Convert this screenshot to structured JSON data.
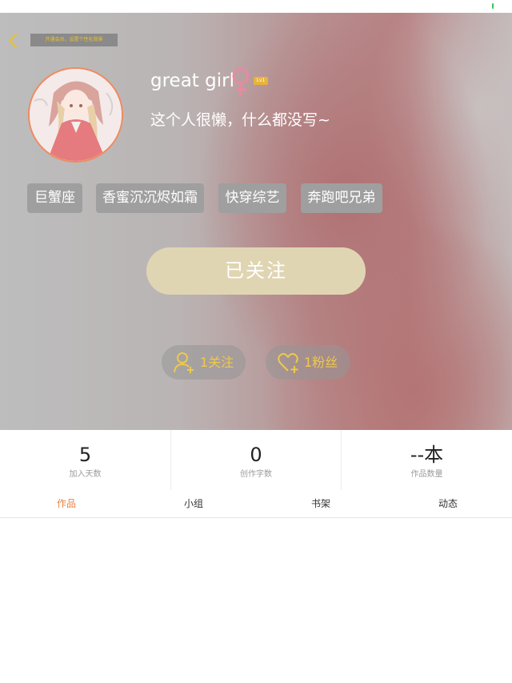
{
  "header": {
    "vip_banner": "开通会员，设置个性化背景"
  },
  "profile": {
    "username": "great girl",
    "gender": "female",
    "level": "Lv1",
    "signature": "这个人很懒，什么都没写~"
  },
  "tags": [
    "巨蟹座",
    "香蜜沉沉烬如霜",
    "快穿综艺",
    "奔跑吧兄弟"
  ],
  "follow_button": "已关注",
  "social": {
    "following": "1关注",
    "fans": "1粉丝"
  },
  "stats": [
    {
      "value": "5",
      "caption": "加入天数"
    },
    {
      "value": "0",
      "caption": "创作字数"
    },
    {
      "value": "--本",
      "caption": "作品数量"
    }
  ],
  "tabs": [
    "作品",
    "小组",
    "书架",
    "动态"
  ],
  "active_tab": "作品",
  "colors": {
    "accent": "#e8823e",
    "follow_button_bg": "#e0d5b3",
    "gold_text": "#eec94b",
    "gender_icon": "#e88aa0",
    "avatar_border": "#f08a5d"
  },
  "icons": {
    "back": "chevron-left-icon",
    "gender": "female-symbol-icon",
    "following": "person-add-icon",
    "fans": "heart-add-icon"
  }
}
